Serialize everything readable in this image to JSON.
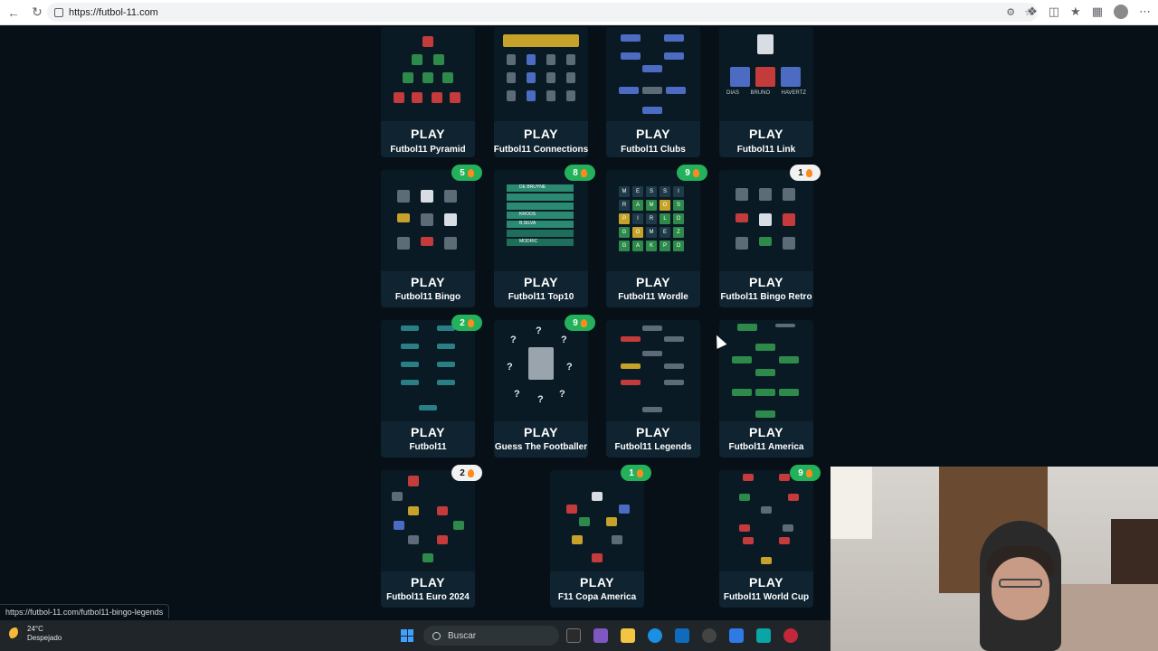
{
  "browser": {
    "url": "https://futbol-11.com"
  },
  "cards": [
    {
      "id": "pyramid",
      "play": "PLAY",
      "title": "Futbol11 Pyramid",
      "badge": "",
      "badge_style": "green"
    },
    {
      "id": "connections",
      "play": "PLAY",
      "title": "Futbol11 Connections",
      "badge": "",
      "badge_style": "green"
    },
    {
      "id": "clubs",
      "play": "PLAY",
      "title": "Futbol11 Clubs",
      "badge": "",
      "badge_style": "green"
    },
    {
      "id": "link",
      "play": "PLAY",
      "title": "Futbol11 Link",
      "badge": "",
      "badge_style": "green",
      "thumb_labels": [
        "DIAS",
        "BRUNO",
        "HAVERTZ"
      ]
    },
    {
      "id": "bingo",
      "play": "PLAY",
      "title": "Futbol11 Bingo",
      "badge": "5",
      "badge_style": "green"
    },
    {
      "id": "top10",
      "play": "PLAY",
      "title": "Futbol11 Top10",
      "badge": "8",
      "badge_style": "green",
      "thumb_labels": [
        "DE BRUYNE",
        "KROOS",
        "B.SILVA",
        "MODRIC"
      ]
    },
    {
      "id": "wordle",
      "play": "PLAY",
      "title": "Futbol11 Wordle",
      "badge": "9",
      "badge_style": "green",
      "thumb_letters": [
        "M",
        "E",
        "S",
        "S",
        "I",
        "R",
        "A",
        "M",
        "O",
        "S",
        "P",
        "I",
        "R",
        "L",
        "O",
        "G",
        "O",
        "M",
        "E",
        "Z",
        "G",
        "A",
        "K",
        "P",
        "O"
      ]
    },
    {
      "id": "bingo-retro",
      "play": "PLAY",
      "title": "Futbol11 Bingo Retro",
      "badge": "1",
      "badge_style": "white"
    },
    {
      "id": "futbol11",
      "play": "PLAY",
      "title": "Futbol11",
      "badge": "2",
      "badge_style": "green"
    },
    {
      "id": "guess",
      "play": "PLAY",
      "title": "Guess The Footballer",
      "badge": "9",
      "badge_style": "green"
    },
    {
      "id": "legends",
      "play": "PLAY",
      "title": "Futbol11 Legends",
      "badge": "",
      "badge_style": "green"
    },
    {
      "id": "america",
      "play": "PLAY",
      "title": "Futbol11 America",
      "badge": "",
      "badge_style": "green"
    },
    {
      "id": "euro",
      "play": "PLAY",
      "title": "Futbol11 Euro 2024",
      "badge": "2",
      "badge_style": "white"
    },
    {
      "id": "copa",
      "play": "PLAY",
      "title": "F11 Copa America",
      "badge": "1",
      "badge_style": "green"
    },
    {
      "id": "worldcup",
      "play": "PLAY",
      "title": "Futbol11 World Cup",
      "badge": "9",
      "badge_style": "green"
    }
  ],
  "status_url": "https://futbol-11.com/futbol11-bingo-legends",
  "taskbar": {
    "temperature": "24°C",
    "weather": "Despejado",
    "search_placeholder": "Buscar"
  }
}
